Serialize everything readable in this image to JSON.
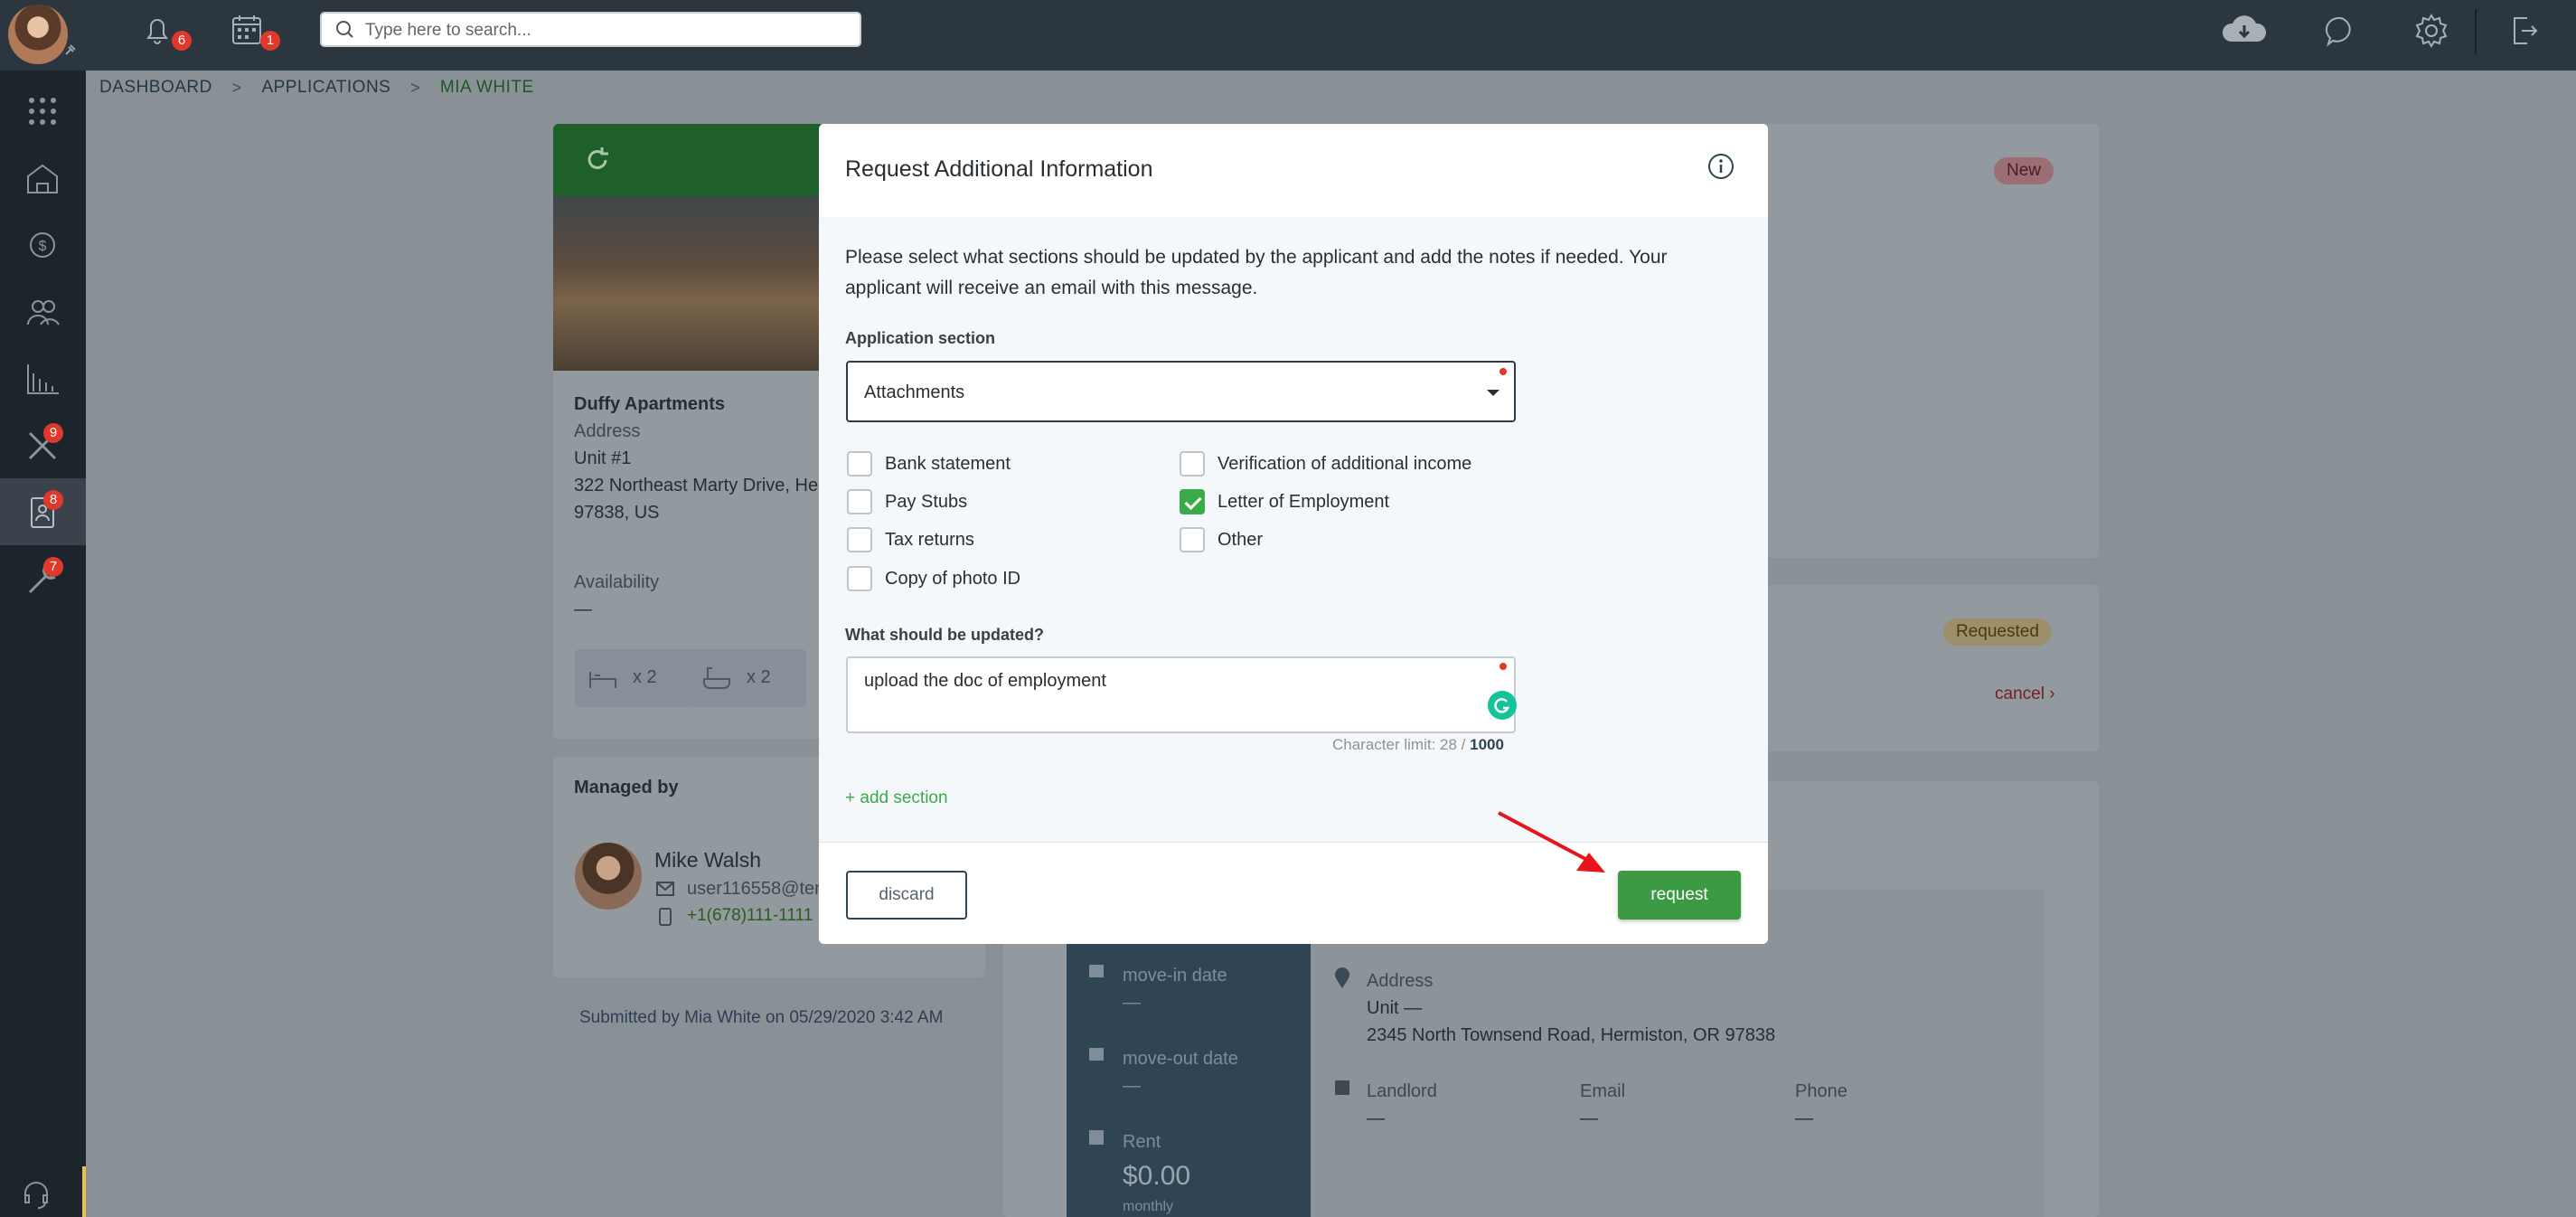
{
  "topbar": {
    "notifications_count": "6",
    "calendar_count": "1",
    "search_placeholder": "Type here to search..."
  },
  "breadcrumb": {
    "items": [
      "DASHBOARD",
      "APPLICATIONS",
      "MIA WHITE"
    ],
    "separator": ">"
  },
  "sidebar": {
    "tools_count": "9",
    "applications_count": "8",
    "maintenance_count": "7"
  },
  "property": {
    "name": "Duffy Apartments",
    "address_label": "Address",
    "unit": "Unit #1",
    "street": "322 Northeast Marty Drive, He",
    "zip": "97838, US",
    "availability_label": "Availability",
    "availability_value": "—",
    "beds": "x 2",
    "baths": "x 2"
  },
  "manager": {
    "section_title": "Managed by",
    "name": "Mike Walsh",
    "email": "user116558@ter",
    "phone": "+1(678)111-1111"
  },
  "submitted": "Submitted by Mia White on 05/29/2020 3:42 AM",
  "status": {
    "badge_new": "New",
    "badge_requested": "Requested",
    "cancel_link": "cancel ›"
  },
  "lease": {
    "movein_label": "move-in date",
    "movein_value": "—",
    "moveout_label": "move-out date",
    "moveout_value": "—",
    "rent_label": "Rent",
    "rent_value": "$0.00",
    "rent_period": "monthly",
    "address_label": "Address",
    "address_unit": "Unit —",
    "address_street": "2345 North Townsend Road, Hermiston, OR 97838",
    "landlord_label": "Landlord",
    "landlord_value": "—",
    "email_label": "Email",
    "email_value": "—",
    "phone_label": "Phone",
    "phone_value": "—"
  },
  "modal": {
    "title": "Request Additional Information",
    "description": "Please select what sections should be updated by the applicant and add the notes if needed. Your applicant will receive an email with this message.",
    "section_label": "Application section",
    "section_value": "Attachments",
    "checkboxes": [
      {
        "label": "Bank statement",
        "checked": false
      },
      {
        "label": "Pay Stubs",
        "checked": false
      },
      {
        "label": "Tax returns",
        "checked": false
      },
      {
        "label": "Copy of photo ID",
        "checked": false
      },
      {
        "label": "Verification of additional income",
        "checked": false
      },
      {
        "label": "Letter of Employment",
        "checked": true
      },
      {
        "label": "Other",
        "checked": false
      }
    ],
    "notes_label": "What should be updated?",
    "notes_value": "upload the doc of employment",
    "char_limit_prefix": "Character limit: 28 /",
    "char_limit_max": "1000",
    "add_section": "+ add section",
    "discard": "discard",
    "request": "request"
  },
  "colors": {
    "accent_green": "#3c9a44",
    "badge_red": "#e0392b",
    "annotation_arrow": "#e8141b"
  }
}
